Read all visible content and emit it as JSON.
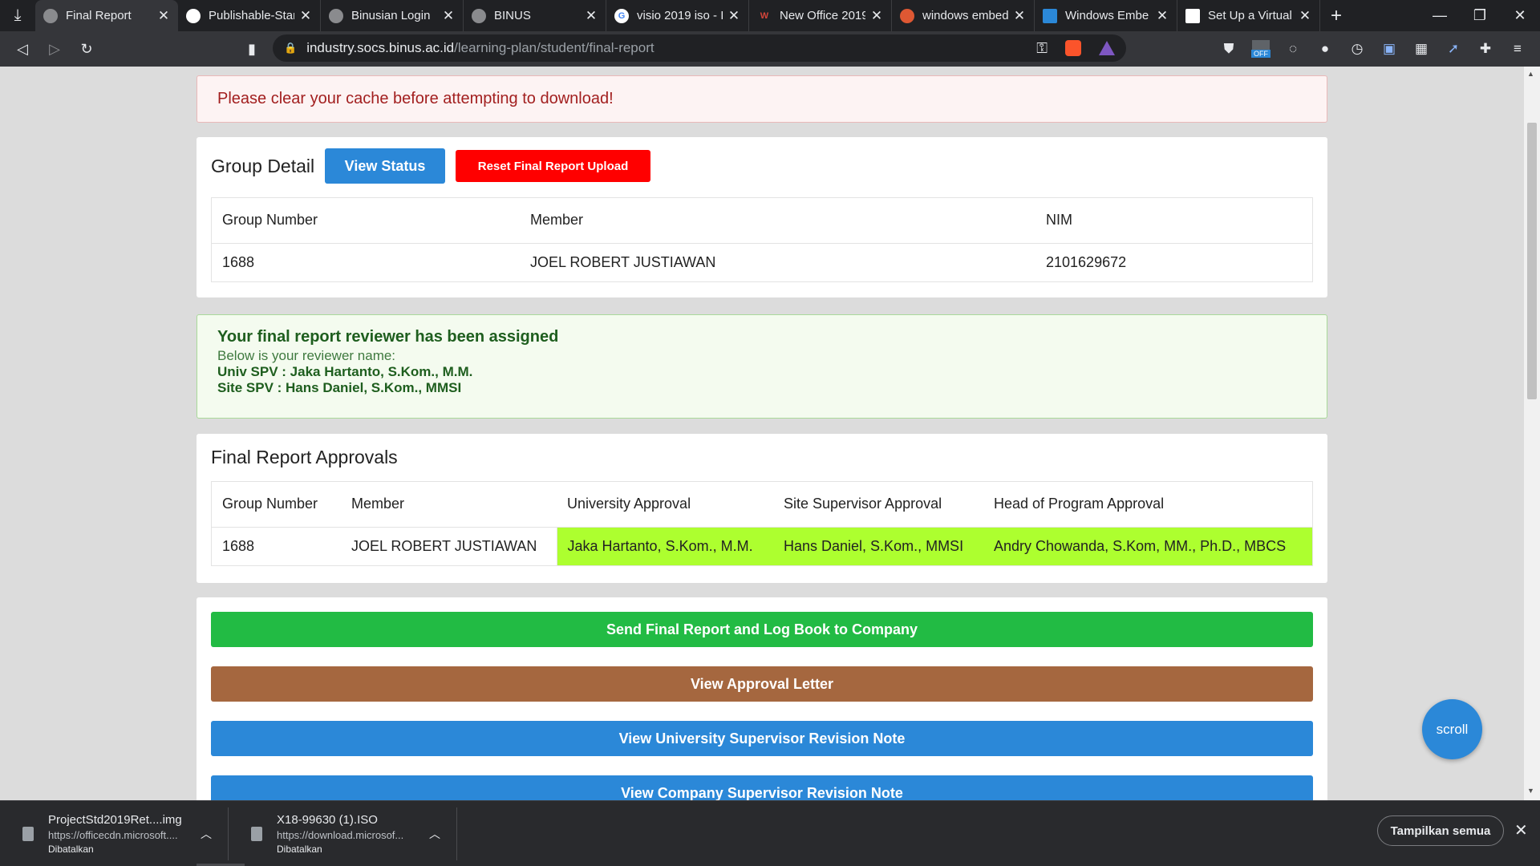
{
  "browser": {
    "tabs": [
      {
        "title": "Final Report",
        "favicon": "binus-icon",
        "color": "#8a8b8e"
      },
      {
        "title": "Publishable-Star",
        "favicon": "github-icon",
        "color": "#ffffff"
      },
      {
        "title": "Binusian Login",
        "favicon": "binus-icon",
        "color": "#8a8b8e"
      },
      {
        "title": "BINUS",
        "favicon": "binus-icon",
        "color": "#8a8b8e"
      },
      {
        "title": "visio 2019 iso - I",
        "favicon": "google-icon",
        "color": "#ffffff"
      },
      {
        "title": "New Office 2019",
        "favicon": "w-icon",
        "color": "#d4453a"
      },
      {
        "title": "windows embed",
        "favicon": "duckduckgo-icon",
        "color": "#de5833"
      },
      {
        "title": "Windows Embe",
        "favicon": "windows-icon",
        "color": "#2b88d8"
      },
      {
        "title": "Set Up a Virtual",
        "favicon": "doc-icon",
        "color": "#ffffff"
      }
    ],
    "url_domain": "industry.socs.binus.ac.id",
    "url_path": "/learning-plan/student/final-report",
    "ext_off_badge": "OFF"
  },
  "page": {
    "cache_alert": "Please clear your cache before attempting to download!",
    "group_detail": {
      "title": "Group Detail",
      "view_status": "View Status",
      "reset_upload": "Reset Final Report Upload",
      "headers": {
        "group_number": "Group Number",
        "member": "Member",
        "nim": "NIM"
      },
      "row": {
        "group_number": "1688",
        "member": "JOEL ROBERT JUSTIAWAN",
        "nim": "2101629672"
      }
    },
    "reviewer": {
      "heading": "Your final report reviewer has been assigned",
      "sub": "Below is your reviewer name:",
      "univ": "Univ SPV : Jaka Hartanto, S.Kom., M.M.",
      "site": "Site SPV : Hans Daniel, S.Kom., MMSI"
    },
    "approvals": {
      "title": "Final Report Approvals",
      "headers": {
        "group_number": "Group Number",
        "member": "Member",
        "university": "University Approval",
        "site": "Site Supervisor Approval",
        "head": "Head of Program Approval"
      },
      "row": {
        "group_number": "1688",
        "member": "JOEL ROBERT JUSTIAWAN",
        "university": "Jaka Hartanto, S.Kom., M.M.",
        "site": "Hans Daniel, S.Kom., MMSI",
        "head": "Andry Chowanda, S.Kom, MM., Ph.D., MBCS"
      },
      "approved_color": "#adff2f"
    },
    "actions": {
      "send": {
        "label": "Send Final Report and Log Book to Company",
        "color": "#22bb44"
      },
      "approval_letter": {
        "label": "View Approval Letter",
        "color": "#a5673f"
      },
      "univ_note": {
        "label": "View University Supervisor Revision Note",
        "color": "#2b88d8"
      },
      "company_note": {
        "label": "View Company Supervisor Revision Note",
        "color": "#2b88d8"
      }
    },
    "scroll_button": "scroll"
  },
  "downloads": {
    "items": [
      {
        "name": "ProjectStd2019Ret....img",
        "url": "https://officecdn.microsoft....",
        "status": "Dibatalkan"
      },
      {
        "name": "X18-99630 (1).ISO",
        "url": "https://download.microsof...",
        "status": "Dibatalkan"
      }
    ],
    "show_all": "Tampilkan semua"
  }
}
